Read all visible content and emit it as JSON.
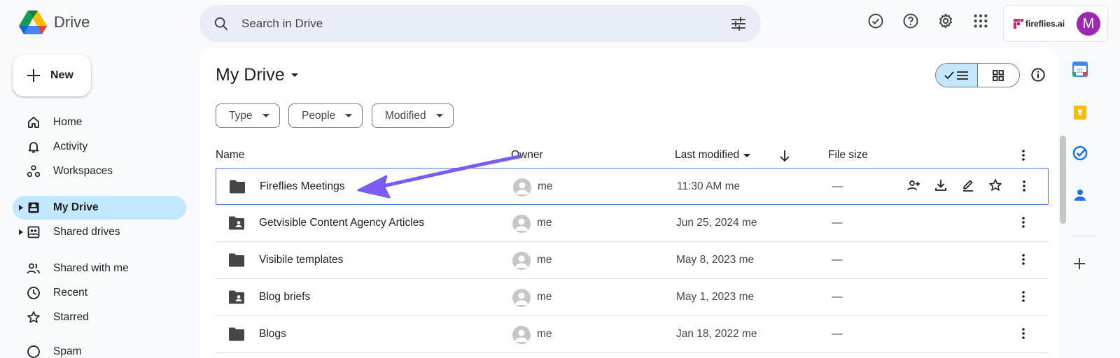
{
  "app": {
    "name": "Drive"
  },
  "search": {
    "placeholder": "Search in Drive"
  },
  "account": {
    "brand": "fireflies.ai",
    "avatar_letter": "M",
    "avatar_color": "#9c27b0"
  },
  "new_button": {
    "label": "New"
  },
  "sidebar": {
    "items": [
      {
        "label": "Home",
        "icon": "home-icon"
      },
      {
        "label": "Activity",
        "icon": "bell-icon"
      },
      {
        "label": "Workspaces",
        "icon": "workspaces-icon"
      },
      {
        "label": "My Drive",
        "icon": "my-drive-icon",
        "active": true
      },
      {
        "label": "Shared drives",
        "icon": "shared-drives-icon"
      },
      {
        "label": "Shared with me",
        "icon": "people-icon"
      },
      {
        "label": "Recent",
        "icon": "clock-icon"
      },
      {
        "label": "Starred",
        "icon": "star-icon"
      },
      {
        "label": "Spam",
        "icon": "spam-icon"
      }
    ]
  },
  "main": {
    "title": "My Drive",
    "filters": [
      "Type",
      "People",
      "Modified"
    ],
    "columns": {
      "name": "Name",
      "owner": "Owner",
      "modified": "Last modified",
      "size": "File size"
    },
    "rows": [
      {
        "name": "Fireflies Meetings",
        "owner": "me",
        "modified": "11:30 AM me",
        "size": "—",
        "shared": false,
        "selected": true
      },
      {
        "name": "Getvisible Content Agency Articles",
        "owner": "me",
        "modified": "Jun 25, 2024 me",
        "size": "—",
        "shared": true
      },
      {
        "name": "Visibile templates",
        "owner": "me",
        "modified": "May 8, 2023 me",
        "size": "—",
        "shared": false
      },
      {
        "name": "Blog briefs",
        "owner": "me",
        "modified": "May 1, 2023 me",
        "size": "—",
        "shared": true
      },
      {
        "name": "Blogs",
        "owner": "me",
        "modified": "Jan 18, 2022 me",
        "size": "—",
        "shared": false
      }
    ]
  },
  "colors": {
    "accent": "#c2e7ff",
    "annotation_arrow": "#7b5cf0",
    "selection_border": "#4f7cd6"
  }
}
